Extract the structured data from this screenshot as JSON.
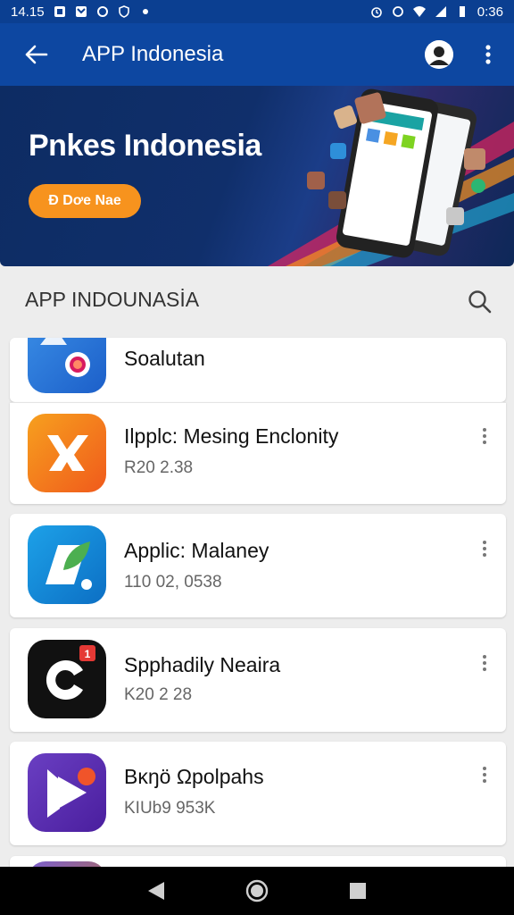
{
  "status_bar": {
    "time": "14.15",
    "battery_time": "0:36"
  },
  "app_bar": {
    "title": "APP Indonesia"
  },
  "banner": {
    "title": "Pnkes Indonesia",
    "cta_label": "Đ Dơe Nae"
  },
  "section": {
    "title": "APP INDOUNASİA"
  },
  "apps": [
    {
      "name": "Soalutan",
      "meta": ""
    },
    {
      "name": "Ilpplc: Mesing Enclonity",
      "meta": "R20 2.38"
    },
    {
      "name": "Applic: Malaney",
      "meta": "110 02, 0538"
    },
    {
      "name": "Spphadily Neaira",
      "meta": "K20 2 28"
    },
    {
      "name": "Bκŋö Ωpolpahs",
      "meta": "KIUb9 953K"
    }
  ]
}
